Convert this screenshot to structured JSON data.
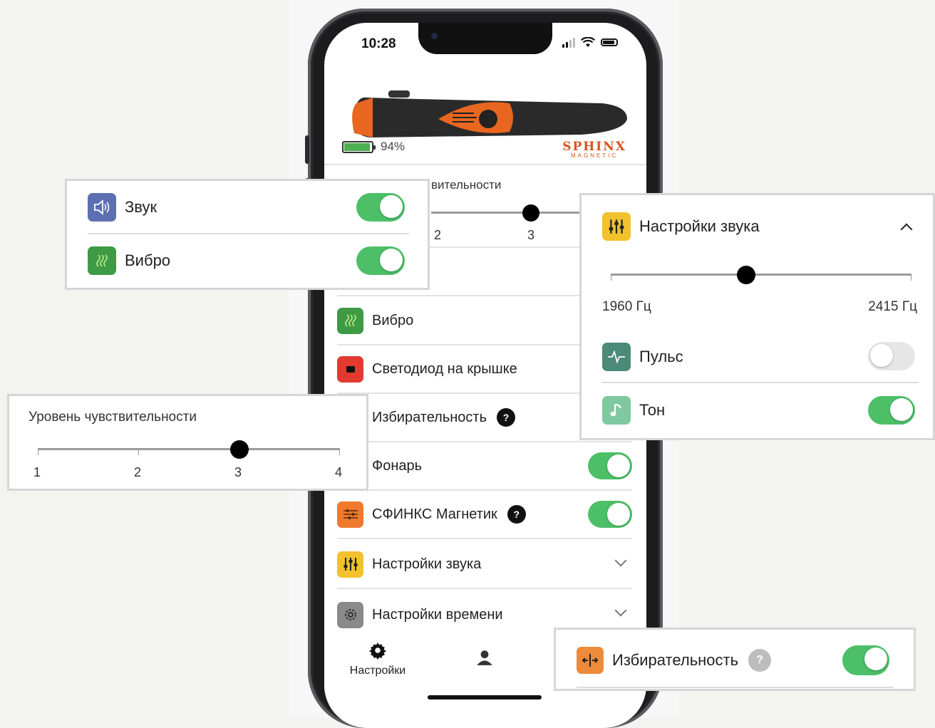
{
  "status_bar": {
    "time": "10:28"
  },
  "device": {
    "battery_percent": 94,
    "battery_text": "94%",
    "brand_top": "SPHINX",
    "brand_bottom": "MAGNETIC"
  },
  "main": {
    "sensitivity_partial_title": "вительности",
    "sensitivity_partial_ticks": [
      "2",
      "3"
    ],
    "rows": [
      {
        "label": "Вибро",
        "icon": "vibration-icon",
        "color": "#3f9a45"
      },
      {
        "label": "Светодиод на крышке",
        "icon": "led-icon",
        "color": "#e23a2f"
      },
      {
        "label": "Избирательность",
        "icon": "help-icon"
      },
      {
        "label": "Фонарь",
        "toggle": true
      },
      {
        "label": "СФИНКС Магнетик",
        "icon": "sliders-icon",
        "color": "#ef7a2d",
        "toggle": true
      },
      {
        "label": "Настройки звука",
        "icon": "equalizer-icon",
        "color": "#f2c12e"
      },
      {
        "label": "Настройки времени",
        "icon": "gear-icon",
        "color": "#8a8a8a"
      }
    ]
  },
  "tabbar": {
    "settings_label": "Настройки",
    "profile_icon": "person-icon"
  },
  "card_sound_vibro": {
    "sound_label": "Звук",
    "sound_on": true,
    "vibro_label": "Вибро",
    "vibro_on": true
  },
  "card_sensitivity": {
    "title": "Уровень чувствительности",
    "ticks": [
      "1",
      "2",
      "3",
      "4"
    ],
    "value": 3
  },
  "card_sound_settings": {
    "title": "Настройки звука",
    "freq_min_label": "1960 Гц",
    "freq_max_label": "2415 Гц",
    "slider_fraction": 0.45,
    "pulse_label": "Пульс",
    "pulse_on": false,
    "tone_label": "Тон",
    "tone_on": true
  },
  "card_selectivity": {
    "label": "Избирательность",
    "help": "?",
    "on": true
  },
  "help_mark": "?",
  "colors": {
    "toggle_on": "#4cbf67",
    "accent_orange": "#d9541f",
    "sound_blue": "#5c6fb0"
  }
}
